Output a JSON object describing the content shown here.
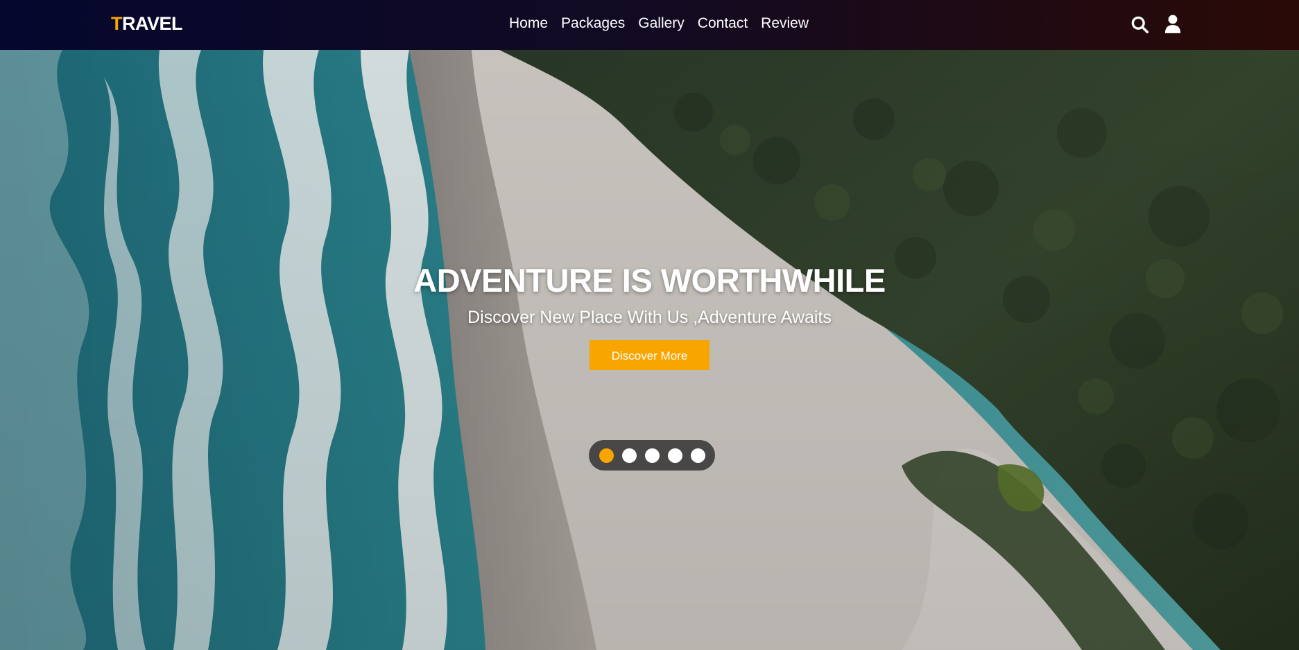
{
  "navbar": {
    "logo_accent": "T",
    "logo_rest": "RAVEL",
    "links": [
      "Home",
      "Packages",
      "Gallery",
      "Contact",
      "Review"
    ],
    "icons": [
      "search-icon",
      "user-icon"
    ]
  },
  "hero": {
    "title": "ADVENTURE IS WORTHWHILE",
    "subtitle": "Discover New Place With Us ,Adventure Awaits",
    "cta_label": "Discover More",
    "slides": {
      "count": 5,
      "active_index": 0
    }
  },
  "colors": {
    "accent": "#f9a500",
    "nav_gradient_start": "#05072e",
    "nav_gradient_end": "#2a0a06",
    "text": "#ffffff"
  }
}
